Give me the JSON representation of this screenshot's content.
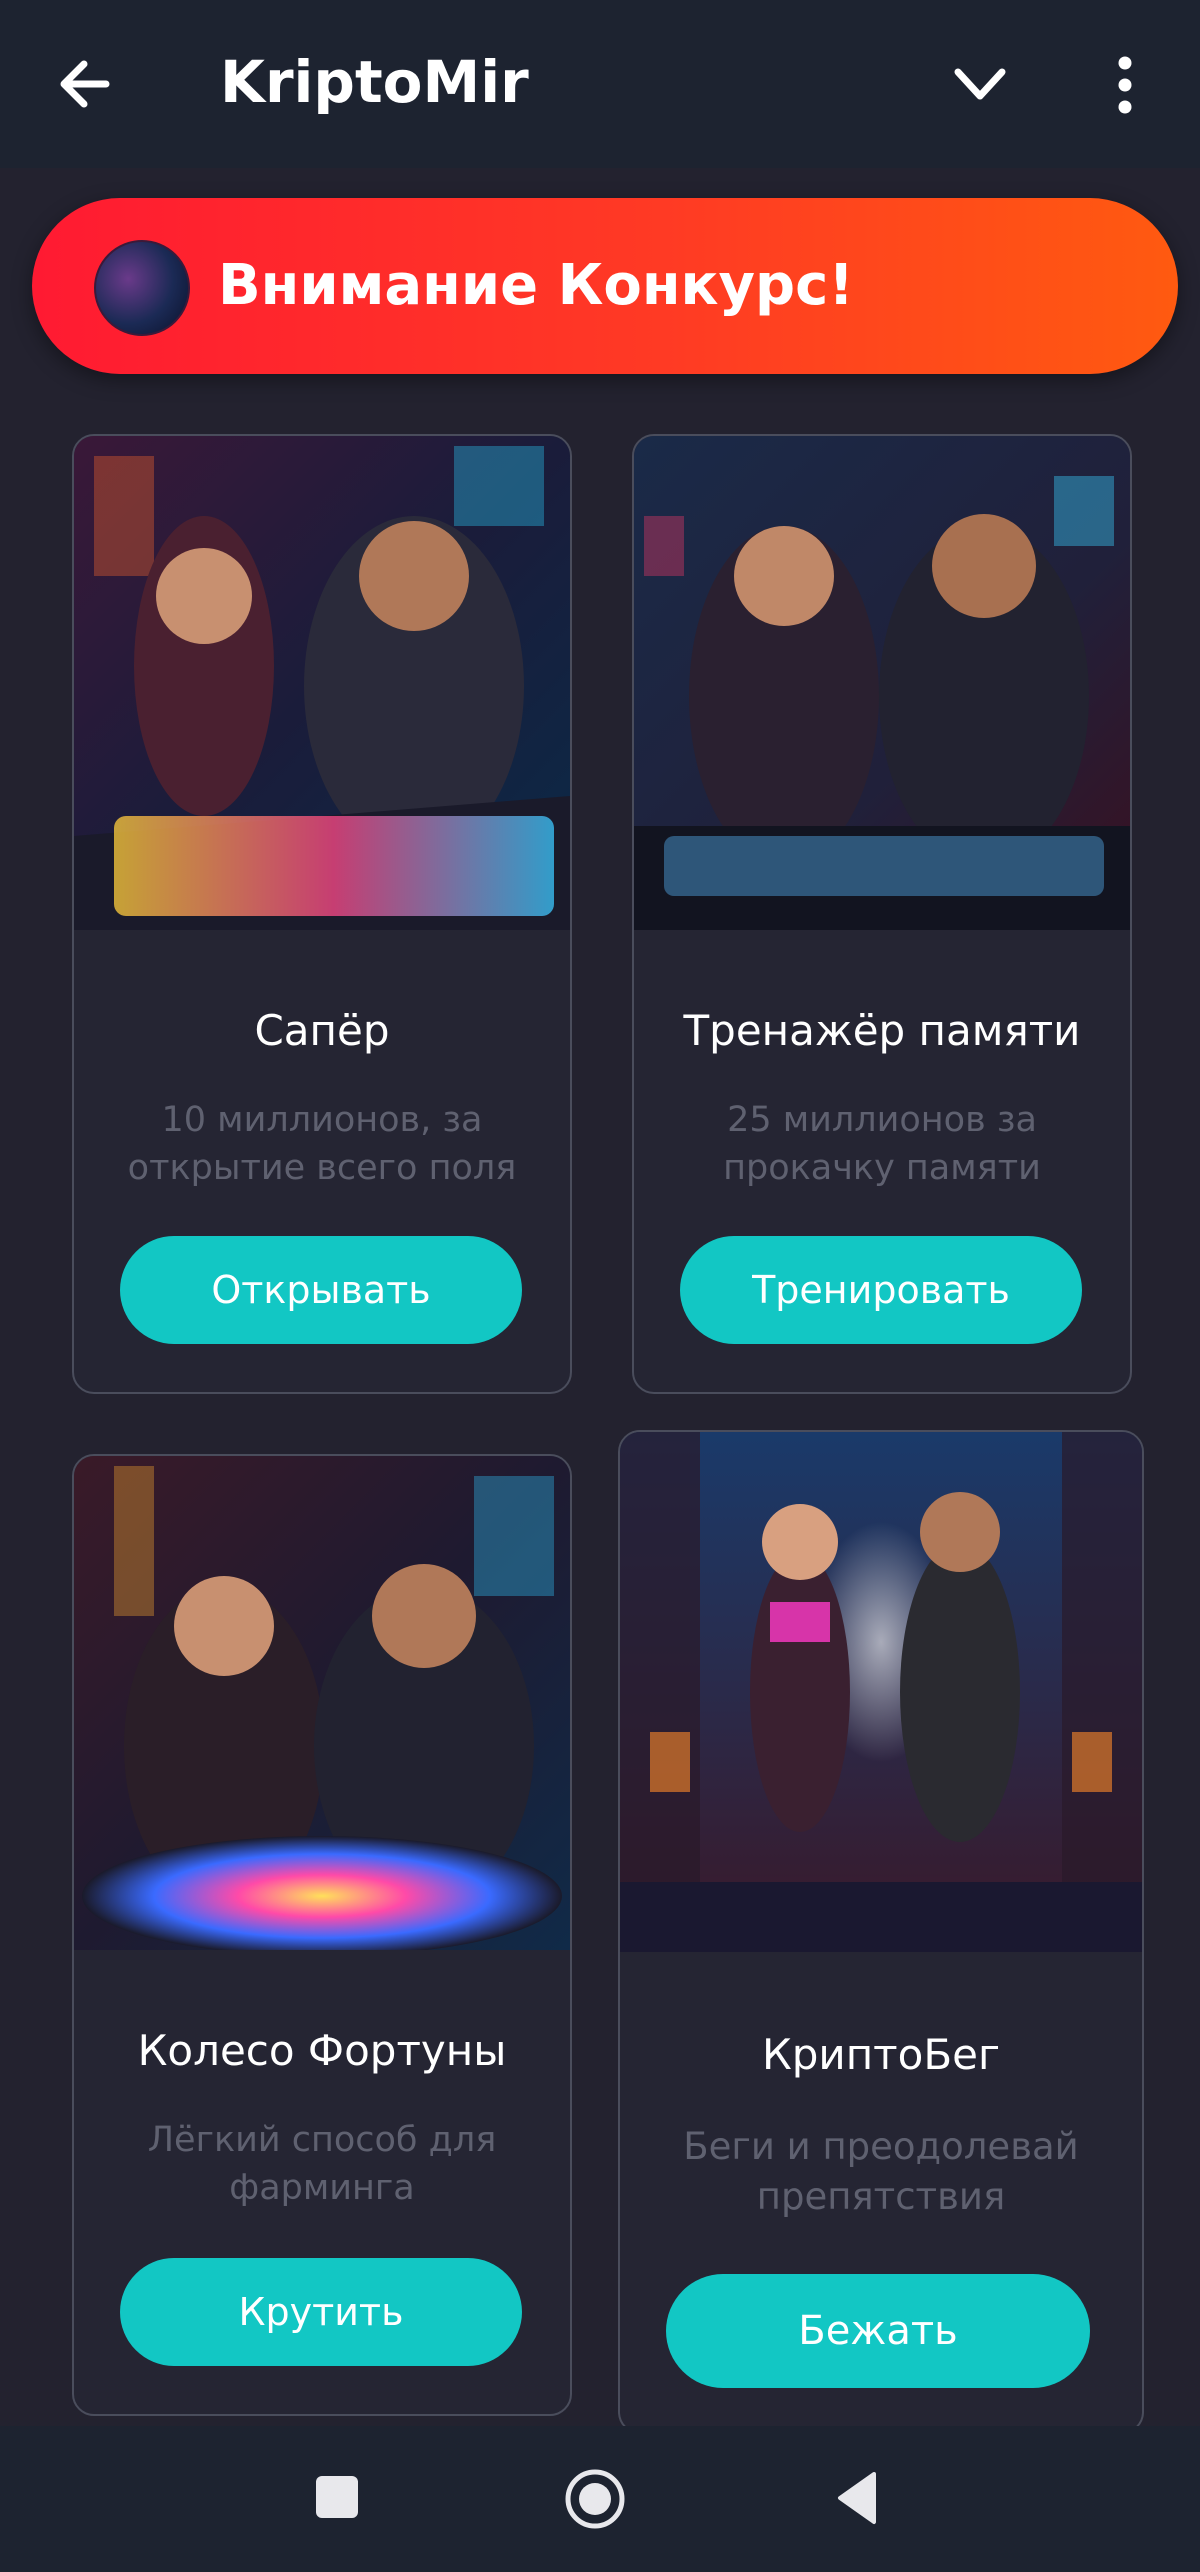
{
  "app": {
    "title": "KriptoMir"
  },
  "banner": {
    "text": "Внимание Конкурс!"
  },
  "cards": [
    {
      "name": "Сапёр",
      "desc": "10 миллионов, за открытие всего поля",
      "button": "Открывать",
      "image": "two people at neon game board"
    },
    {
      "name": "Тренажёр памяти",
      "desc": "25 миллионов за прокачку памяти",
      "button": "Тренировать",
      "image": "two people at neon console"
    },
    {
      "name": "Колесо Фортуны",
      "desc": "Лёгкий способ для фарминга",
      "button": "Крутить",
      "image": "two people at neon wheel"
    },
    {
      "name": "КриптоБег",
      "desc": "Беги и преодолевай препятствия",
      "button": "Бежать",
      "image": "two runners in neon corridor"
    }
  ],
  "colors": {
    "accent": "#12c7c4",
    "banner_start": "#ff1a32",
    "banner_end": "#ff5a10",
    "background": "#23222f",
    "bar": "#1d2330"
  },
  "icons": [
    "back-arrow-icon",
    "chevron-down-icon",
    "more-vert-icon",
    "nav-square-icon",
    "nav-circle-icon",
    "nav-triangle-icon"
  ]
}
